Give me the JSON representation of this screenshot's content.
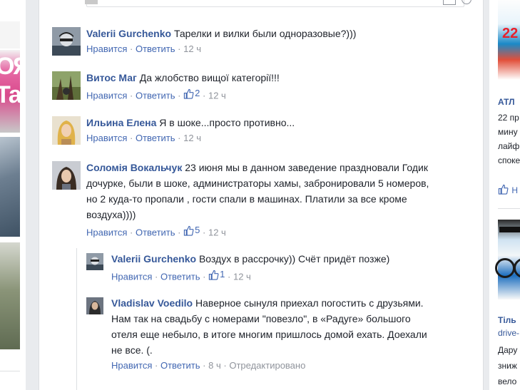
{
  "comments": [
    {
      "author": "Valerii Gurchenko",
      "lines": [
        "Тарелки и вилки были одноразовые?)))"
      ],
      "actions": {
        "like": "Нравится",
        "reply": "Ответить",
        "time": "12 ч"
      }
    },
    {
      "author": "Витос Маг",
      "lines": [
        "Да жлобство вищої категорії!!!"
      ],
      "actions": {
        "like": "Нравится",
        "reply": "Ответить",
        "likes": "2",
        "time": "12 ч"
      }
    },
    {
      "author": "Ильина Елена",
      "lines": [
        "Я в шоке...просто противно..."
      ],
      "actions": {
        "like": "Нравится",
        "reply": "Ответить",
        "time": "12 ч"
      }
    },
    {
      "author": "Соломія Вокальчук",
      "lines": [
        "23 июня мы в данном заведение праздновали Годик",
        "дочурке, были в шоке, администраторы хамы, забронировали 5 номеров,",
        "но 2 куда-то пропали , гости спали в машинах. Платили за все кроме",
        "воздуха))))"
      ],
      "actions": {
        "like": "Нравится",
        "reply": "Ответить",
        "likes": "5",
        "time": "12 ч"
      }
    }
  ],
  "replies": [
    {
      "author": "Valerii Gurchenko",
      "lines": [
        "Воздух в рассрочку)) Счёт придёт позже)"
      ],
      "actions": {
        "like": "Нравится",
        "reply": "Ответить",
        "likes": "1",
        "time": "12 ч"
      }
    },
    {
      "author": "Vladislav Voedilo",
      "lines": [
        "Наверное сынуля приехал погостить с друзьями.",
        "Нам так на свадьбу с номерами \"повезло\", в «Радуге» большого",
        "отеля еще небыло, в итоге многим пришлось домой ехать. Доехали",
        "не все. (."
      ],
      "actions": {
        "like": "Нравится",
        "reply": "Ответить",
        "time": "8 ч",
        "edited": "Отредактировано"
      }
    }
  ],
  "left_column": {
    "thumb_text": "ОЯ",
    "thumb_text2": "Та"
  },
  "right_column": {
    "ad1_number": "22",
    "ad1_title": "АТЛ",
    "ad1_lines": [
      "22 пр",
      "мину",
      "лайф",
      "споке"
    ],
    "ad1_like": "Н",
    "ad2_title": "Тіль",
    "ad2_link": "drive-",
    "ad2_lines": [
      "Дару",
      "зниж",
      "вело"
    ]
  },
  "colors": {
    "link": "#4267b2",
    "author": "#365899",
    "meta": "#90949c",
    "text": "#1d2129",
    "page_bg": "#e9ebee"
  }
}
